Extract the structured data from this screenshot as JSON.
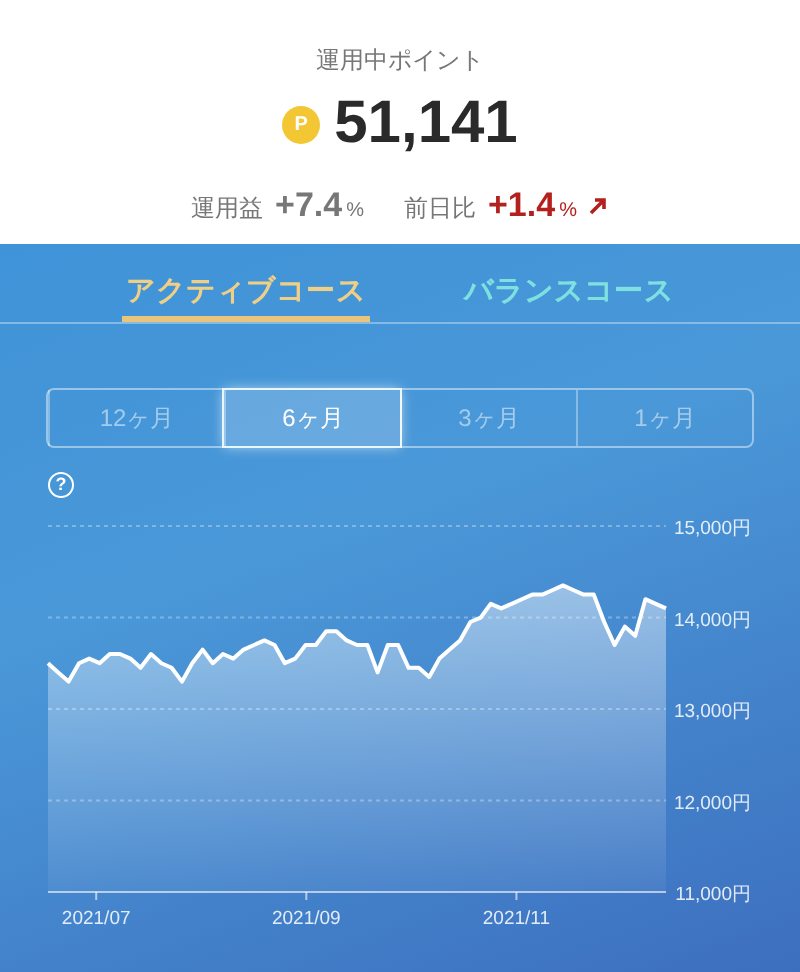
{
  "header": {
    "label": "運用中ポイント",
    "coin": "P",
    "points": "51,141",
    "stats": [
      {
        "label": "運用益",
        "value": "+7.4",
        "unit": "%",
        "color": "#777777",
        "arrow": false
      },
      {
        "label": "前日比",
        "value": "+1.4",
        "unit": "%",
        "color": "#b3201d",
        "arrow": true
      }
    ]
  },
  "course_tabs": [
    {
      "label": "アクティブコース",
      "selected": true
    },
    {
      "label": "バランスコース",
      "selected": false
    }
  ],
  "periods": [
    {
      "label": "12ヶ月",
      "selected": false
    },
    {
      "label": "6ヶ月",
      "selected": true
    },
    {
      "label": "3ヶ月",
      "selected": false
    },
    {
      "label": "1ヶ月",
      "selected": false
    }
  ],
  "help": "?",
  "x_axis_labels": [
    "2021/07",
    "2021/09",
    "2021/11"
  ],
  "chart_data": {
    "type": "area",
    "grid": true,
    "ylim": [
      11000,
      15000
    ],
    "yticks": [
      {
        "value": 11000,
        "label": "11,000円"
      },
      {
        "value": 12000,
        "label": "12,000円"
      },
      {
        "value": 13000,
        "label": "13,000円"
      },
      {
        "value": 14000,
        "label": "14,000円"
      },
      {
        "value": 15000,
        "label": "15,000円"
      }
    ],
    "series": [
      {
        "color": "#ffffff",
        "values": [
          13500,
          13400,
          13300,
          13500,
          13550,
          13500,
          13600,
          13600,
          13550,
          13450,
          13600,
          13500,
          13450,
          13300,
          13500,
          13650,
          13500,
          13600,
          13550,
          13650,
          13700,
          13750,
          13700,
          13500,
          13550,
          13700,
          13700,
          13850,
          13850,
          13750,
          13700,
          13700,
          13400,
          13700,
          13700,
          13450,
          13450,
          13350,
          13550,
          13650,
          13750,
          13950,
          14000,
          14150,
          14100,
          14150,
          14200,
          14250,
          14250,
          14300,
          14350,
          14300,
          14250,
          14250,
          13950,
          13700,
          13900,
          13800,
          14200,
          14150,
          14100
        ]
      }
    ]
  }
}
